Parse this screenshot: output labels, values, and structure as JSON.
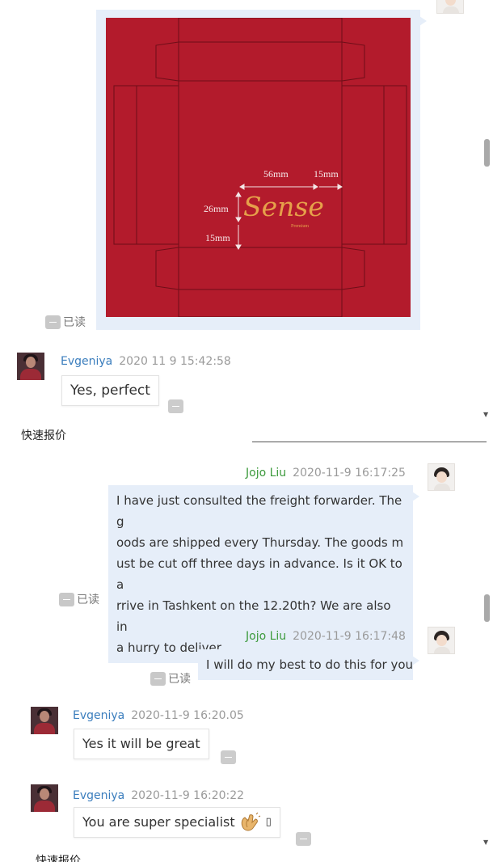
{
  "colors": {
    "bubble_outgoing": "#e6eef9",
    "bubble_incoming": "#ffffff",
    "customer_name": "#3a7dbd",
    "agent_name": "#3c9a3c",
    "timestamp": "#9a9a9a",
    "packaging_red": "#b31b2c",
    "logo_gold": "#e6a04a"
  },
  "top_pane": {
    "image_message": {
      "artwork": {
        "logo_text": "Sense",
        "logo_subtext": "Premium",
        "dim_width": "56mm",
        "dim_margin_right": "15mm",
        "dim_height": "26mm",
        "dim_margin_bottom": "15mm"
      },
      "read_label": "已读"
    },
    "messages": [
      {
        "sender": "Evgeniya",
        "time": "2020 11 9 15:42:58",
        "text": "Yes, perfect"
      }
    ],
    "quick_quote_label": "快速报价"
  },
  "bottom_pane": {
    "messages": [
      {
        "sender": "Jojo Liu",
        "time": "2020-11-9 16:17:25",
        "lines": [
          "I have just consulted the freight forwarder. The g",
          "oods are shipped every Thursday. The goods m",
          "ust be cut off three days in advance. Is it OK to a",
          "rrive in Tashkent on the 12.20th? We are also in",
          "a hurry to deliver."
        ],
        "read_label": "已读"
      },
      {
        "sender": "Jojo Liu",
        "time": "2020-11-9 16:17:48",
        "text": "I will do my best to do this for you",
        "read_label": "已读"
      },
      {
        "sender": "Evgeniya",
        "time": "2020-11-9 16:20.05",
        "text": "Yes it will be great"
      },
      {
        "sender": "Evgeniya",
        "time": "2020-11-9 16:20:22",
        "text": "You are super specialist",
        "emoji_icon": "clapping-hands-icon",
        "trailing_glyph": "▯"
      }
    ],
    "quick_quote_label": "快速报价"
  }
}
